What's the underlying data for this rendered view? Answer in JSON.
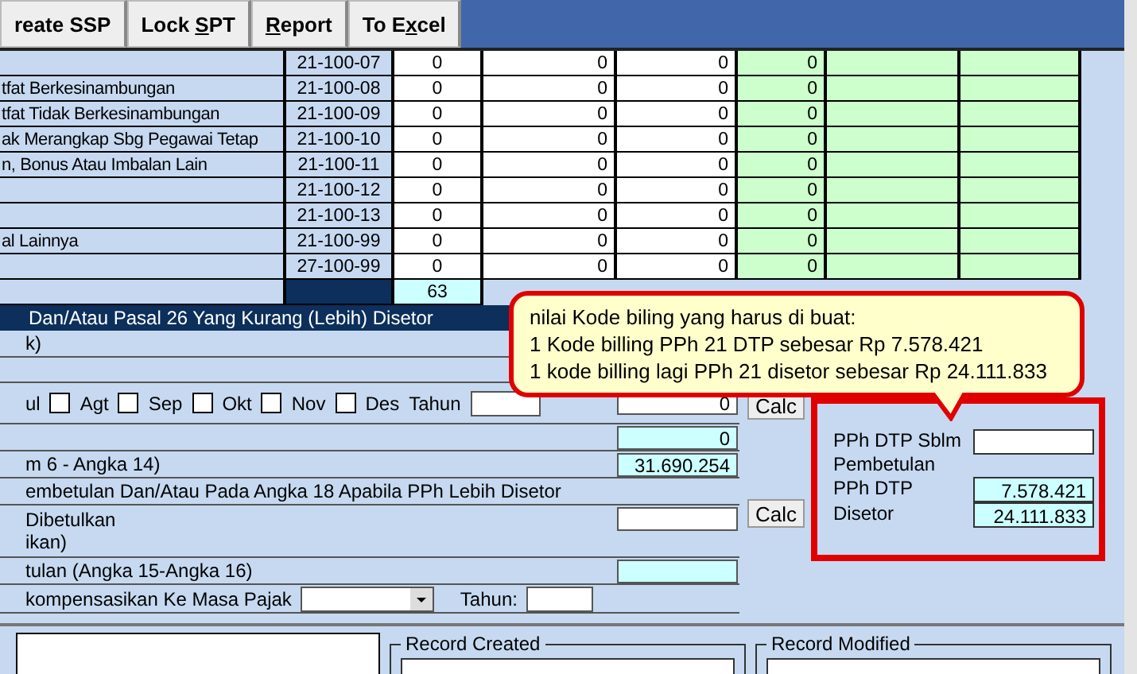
{
  "toolbar": {
    "buttons": [
      {
        "label": "reate SSP"
      },
      {
        "pre": "Lock ",
        "key": "S",
        "post": "PT"
      },
      {
        "key": "R",
        "post": "eport"
      },
      {
        "pre": "To E",
        "key": "x",
        "post": "cel"
      }
    ]
  },
  "table": {
    "rows": [
      {
        "code": "21-100-07",
        "values": [
          "0",
          "0",
          "0",
          "0"
        ]
      },
      {
        "label": "tfat Berkesinambungan",
        "code": "21-100-08",
        "values": [
          "0",
          "0",
          "0",
          "0"
        ]
      },
      {
        "label": "tfat Tidak Berkesinambungan",
        "code": "21-100-09",
        "values": [
          "0",
          "0",
          "0",
          "0"
        ]
      },
      {
        "label": "ak Merangkap Sbg Pegawai Tetap",
        "code": "21-100-10",
        "values": [
          "0",
          "0",
          "0",
          "0"
        ]
      },
      {
        "label": "n, Bonus Atau Imbalan Lain",
        "code": "21-100-11",
        "values": [
          "0",
          "0",
          "0",
          "0"
        ]
      },
      {
        "code": "21-100-12",
        "values": [
          "0",
          "0",
          "0",
          "0"
        ]
      },
      {
        "code": "21-100-13",
        "values": [
          "0",
          "0",
          "0",
          "0"
        ]
      },
      {
        "label": "al Lainnya",
        "code": "21-100-99",
        "values": [
          "0",
          "0",
          "0",
          "0"
        ]
      },
      {
        "code": "27-100-99",
        "values": [
          "0",
          "0",
          "0",
          "0"
        ]
      }
    ],
    "total": "63"
  },
  "form": {
    "header": "Dan/Atau Pasal 26 Yang Kurang (Lebih) Disetor",
    "line_1": "k)",
    "month_fragment": "ul",
    "months": [
      {
        "label": "Agt",
        "checked": false
      },
      {
        "label": "Sep",
        "checked": false
      },
      {
        "label": "Okt",
        "checked": false
      },
      {
        "label": "Nov",
        "checked": false
      },
      {
        "label": "Des",
        "checked": false
      }
    ],
    "year_label": "Tahun",
    "calc_value": "0",
    "calc_button": "Calc",
    "value_2": "0",
    "line_3": "m 6 - Angka 14)",
    "value_3": "31.690.254",
    "line_4": "embetulan Dan/Atau Pada Angka 18 Apabila PPh Lebih Disetor",
    "line_5a": "Dibetulkan",
    "line_5b": "ikan)",
    "calc_button_2": "Calc",
    "line_6": "tulan (Angka 15-Angka 16)",
    "line_7": "kompensasikan Ke Masa Pajak",
    "year_label_2": "Tahun:"
  },
  "dtp_panel": {
    "fields": [
      {
        "label": "PPh DTP Sblm Pembetulan",
        "kind": "input"
      },
      {
        "label": "PPh DTP",
        "value": "7.578.421",
        "kind": "output"
      },
      {
        "label": "Disetor",
        "value": "24.111.833",
        "kind": "output"
      }
    ]
  },
  "callout": {
    "lines": [
      "nilai Kode biling yang harus di buat:",
      "1 Kode billing PPh 21 DTP sebesar Rp 7.578.421",
      "1 kode billing lagi PPh 21 disetor sebesar Rp 24.111.833"
    ]
  },
  "records": [
    {
      "title": "Record Created"
    },
    {
      "title": "Record Modified"
    }
  ]
}
